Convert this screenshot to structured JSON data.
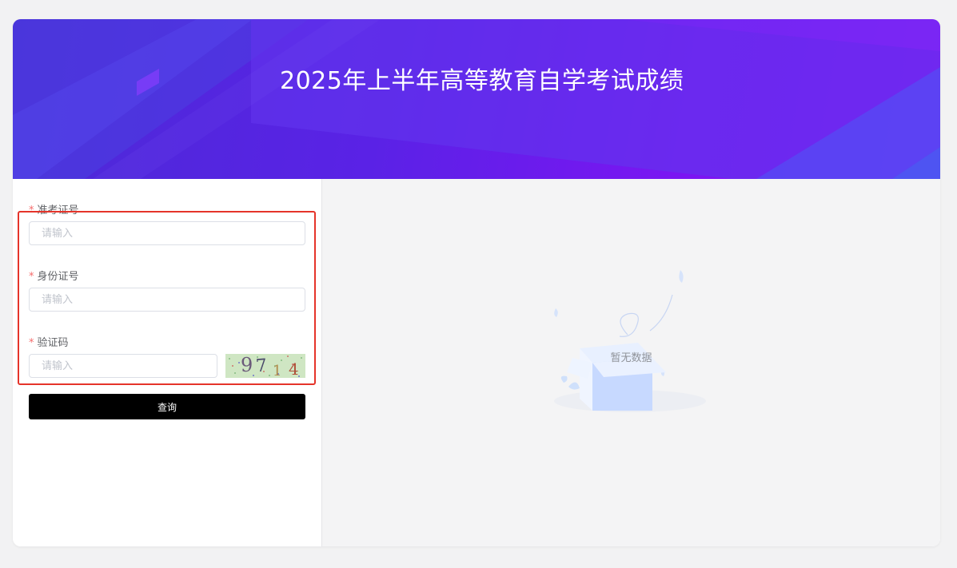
{
  "header": {
    "title": "2025年上半年高等教育自学考试成绩"
  },
  "form": {
    "admission": {
      "label": "准考证号",
      "placeholder": "请输入",
      "required_mark": "*"
    },
    "id_card": {
      "label": "身份证号",
      "placeholder": "请输入",
      "required_mark": "*"
    },
    "captcha": {
      "label": "验证码",
      "placeholder": "请输入",
      "required_mark": "*",
      "image_text": "9714"
    },
    "submit_label": "查询"
  },
  "result": {
    "empty_text": "暂无数据",
    "empty_icon": "empty-box-icon"
  },
  "colors": {
    "banner_start": "#4b2bd6",
    "banner_end": "#8a14f6",
    "required": "#f56c6c",
    "highlight": "#e5342a",
    "button": "#000000"
  }
}
